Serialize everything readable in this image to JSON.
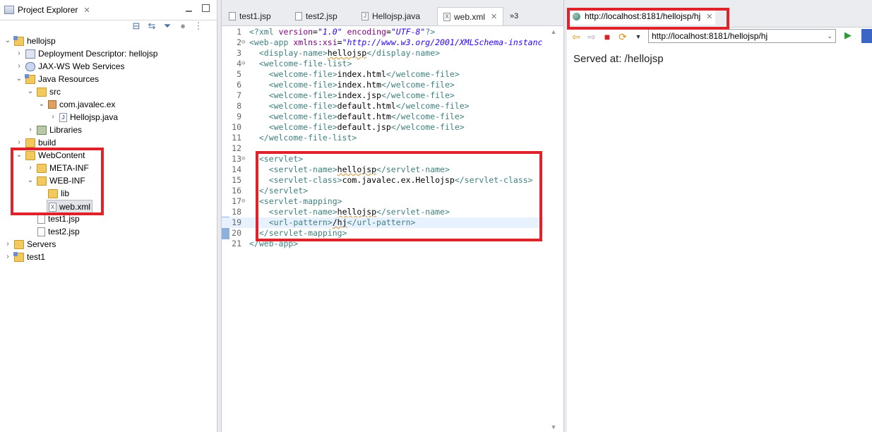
{
  "explorer": {
    "title": "Project Explorer",
    "tree": [
      {
        "label": "hellojsp"
      },
      {
        "label": "Deployment Descriptor: hellojsp"
      },
      {
        "label": "JAX-WS Web Services"
      },
      {
        "label": "Java Resources"
      },
      {
        "label": "src"
      },
      {
        "label": "com.javalec.ex"
      },
      {
        "label": "Hellojsp.java"
      },
      {
        "label": "Libraries"
      },
      {
        "label": "build"
      },
      {
        "label": "WebContent"
      },
      {
        "label": "META-INF"
      },
      {
        "label": "WEB-INF"
      },
      {
        "label": "lib"
      },
      {
        "label": "web.xml"
      },
      {
        "label": "test1.jsp"
      },
      {
        "label": "test2.jsp"
      },
      {
        "label": "Servers"
      },
      {
        "label": "test1"
      }
    ]
  },
  "editor": {
    "tabs": [
      {
        "label": "test1.jsp"
      },
      {
        "label": "test2.jsp"
      },
      {
        "label": "Hellojsp.java"
      },
      {
        "label": "web.xml"
      }
    ],
    "overflow": "»3",
    "line_numbers": [
      "1",
      "2",
      "3",
      "4",
      "5",
      "6",
      "7",
      "8",
      "9",
      "10",
      "11",
      "12",
      "13",
      "14",
      "15",
      "16",
      "17",
      "18",
      "19",
      "20",
      "21"
    ]
  },
  "browser": {
    "tab_title": "http://localhost:8181/hellojsp/hj",
    "url": "http://localhost:8181/hellojsp/hj",
    "content": "Served at: /hellojsp"
  },
  "colors": {
    "highlight": "#e0222a",
    "xml_tag": "#3f7f7f",
    "xml_attr": "#7f007f",
    "xml_value": "#2a00ff"
  }
}
